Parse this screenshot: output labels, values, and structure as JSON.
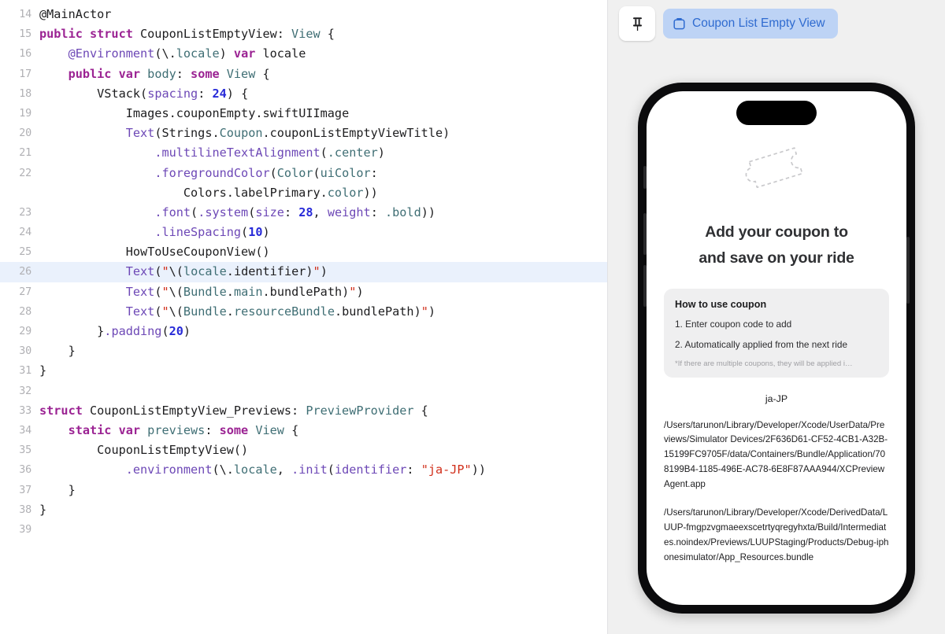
{
  "editor": {
    "language": "swift",
    "highlighted_line": 26,
    "first_line_number": 14,
    "lines": [
      {
        "n": 14,
        "tokens": [
          {
            "t": "@MainActor",
            "c": "plain"
          }
        ]
      },
      {
        "n": 15,
        "tokens": [
          {
            "t": "public struct ",
            "c": "kw"
          },
          {
            "t": "CouponListEmptyView",
            "c": "plain"
          },
          {
            "t": ": ",
            "c": "plain"
          },
          {
            "t": "View",
            "c": "type"
          },
          {
            "t": " {",
            "c": "plain"
          }
        ]
      },
      {
        "n": 16,
        "tokens": [
          {
            "t": "    ",
            "c": "plain"
          },
          {
            "t": "@Environment",
            "c": "attr"
          },
          {
            "t": "(\\.",
            "c": "plain"
          },
          {
            "t": "locale",
            "c": "prop"
          },
          {
            "t": ") ",
            "c": "plain"
          },
          {
            "t": "var ",
            "c": "kw"
          },
          {
            "t": "locale",
            "c": "plain"
          }
        ]
      },
      {
        "n": 17,
        "tokens": [
          {
            "t": "    ",
            "c": "plain"
          },
          {
            "t": "public var ",
            "c": "kw"
          },
          {
            "t": "body",
            "c": "type"
          },
          {
            "t": ": ",
            "c": "plain"
          },
          {
            "t": "some ",
            "c": "kw"
          },
          {
            "t": "View",
            "c": "type"
          },
          {
            "t": " {",
            "c": "plain"
          }
        ]
      },
      {
        "n": 18,
        "tokens": [
          {
            "t": "        ",
            "c": "plain"
          },
          {
            "t": "VStack",
            "c": "plain"
          },
          {
            "t": "(",
            "c": "plain"
          },
          {
            "t": "spacing",
            "c": "meth"
          },
          {
            "t": ": ",
            "c": "plain"
          },
          {
            "t": "24",
            "c": "num"
          },
          {
            "t": ") {",
            "c": "plain"
          }
        ]
      },
      {
        "n": 19,
        "tokens": [
          {
            "t": "            ",
            "c": "plain"
          },
          {
            "t": "Images",
            "c": "plain"
          },
          {
            "t": ".couponEmpty",
            "c": "plain"
          },
          {
            "t": ".swiftUIImage",
            "c": "plain"
          }
        ]
      },
      {
        "n": 20,
        "tokens": [
          {
            "t": "            ",
            "c": "plain"
          },
          {
            "t": "Text",
            "c": "meth"
          },
          {
            "t": "(",
            "c": "plain"
          },
          {
            "t": "Strings",
            "c": "plain"
          },
          {
            "t": ".",
            "c": "plain"
          },
          {
            "t": "Coupon",
            "c": "type"
          },
          {
            "t": ".couponListEmptyViewTitle",
            "c": "plain"
          },
          {
            "t": ")",
            "c": "plain"
          }
        ]
      },
      {
        "n": 21,
        "tokens": [
          {
            "t": "                ",
            "c": "plain"
          },
          {
            "t": ".multilineTextAlignment",
            "c": "meth"
          },
          {
            "t": "(",
            "c": "plain"
          },
          {
            "t": ".center",
            "c": "prop"
          },
          {
            "t": ")",
            "c": "plain"
          }
        ]
      },
      {
        "n": 22,
        "tokens": [
          {
            "t": "                ",
            "c": "plain"
          },
          {
            "t": ".foregroundColor",
            "c": "meth"
          },
          {
            "t": "(",
            "c": "plain"
          },
          {
            "t": "Color",
            "c": "type"
          },
          {
            "t": "(",
            "c": "plain"
          },
          {
            "t": "uiColor",
            "c": "type"
          },
          {
            "t": ":",
            "c": "plain"
          }
        ]
      },
      {
        "n": null,
        "tokens": [
          {
            "t": "                    ",
            "c": "plain"
          },
          {
            "t": "Colors",
            "c": "plain"
          },
          {
            "t": ".labelPrimary",
            "c": "plain"
          },
          {
            "t": ".",
            "c": "plain"
          },
          {
            "t": "color",
            "c": "prop"
          },
          {
            "t": "))",
            "c": "plain"
          }
        ]
      },
      {
        "n": 23,
        "tokens": [
          {
            "t": "                ",
            "c": "plain"
          },
          {
            "t": ".font",
            "c": "meth"
          },
          {
            "t": "(",
            "c": "plain"
          },
          {
            "t": ".system",
            "c": "meth"
          },
          {
            "t": "(",
            "c": "plain"
          },
          {
            "t": "size",
            "c": "meth"
          },
          {
            "t": ": ",
            "c": "plain"
          },
          {
            "t": "28",
            "c": "num"
          },
          {
            "t": ", ",
            "c": "plain"
          },
          {
            "t": "weight",
            "c": "meth"
          },
          {
            "t": ": ",
            "c": "plain"
          },
          {
            "t": ".bold",
            "c": "prop"
          },
          {
            "t": "))",
            "c": "plain"
          }
        ]
      },
      {
        "n": 24,
        "tokens": [
          {
            "t": "                ",
            "c": "plain"
          },
          {
            "t": ".lineSpacing",
            "c": "meth"
          },
          {
            "t": "(",
            "c": "plain"
          },
          {
            "t": "10",
            "c": "num"
          },
          {
            "t": ")",
            "c": "plain"
          }
        ]
      },
      {
        "n": 25,
        "tokens": [
          {
            "t": "            ",
            "c": "plain"
          },
          {
            "t": "HowToUseCouponView",
            "c": "plain"
          },
          {
            "t": "()",
            "c": "plain"
          }
        ]
      },
      {
        "n": 26,
        "tokens": [
          {
            "t": "            ",
            "c": "plain"
          },
          {
            "t": "Text",
            "c": "meth"
          },
          {
            "t": "(",
            "c": "plain"
          },
          {
            "t": "\"",
            "c": "str"
          },
          {
            "t": "\\(",
            "c": "plain"
          },
          {
            "t": "locale",
            "c": "prop"
          },
          {
            "t": ".identifier",
            "c": "plain"
          },
          {
            "t": ")",
            "c": "plain"
          },
          {
            "t": "\"",
            "c": "str"
          },
          {
            "t": ")",
            "c": "plain"
          }
        ]
      },
      {
        "n": 27,
        "tokens": [
          {
            "t": "            ",
            "c": "plain"
          },
          {
            "t": "Text",
            "c": "meth"
          },
          {
            "t": "(",
            "c": "plain"
          },
          {
            "t": "\"",
            "c": "str"
          },
          {
            "t": "\\(",
            "c": "plain"
          },
          {
            "t": "Bundle",
            "c": "type"
          },
          {
            "t": ".",
            "c": "plain"
          },
          {
            "t": "main",
            "c": "prop"
          },
          {
            "t": ".bundlePath",
            "c": "plain"
          },
          {
            "t": ")",
            "c": "plain"
          },
          {
            "t": "\"",
            "c": "str"
          },
          {
            "t": ")",
            "c": "plain"
          }
        ]
      },
      {
        "n": 28,
        "tokens": [
          {
            "t": "            ",
            "c": "plain"
          },
          {
            "t": "Text",
            "c": "meth"
          },
          {
            "t": "(",
            "c": "plain"
          },
          {
            "t": "\"",
            "c": "str"
          },
          {
            "t": "\\(",
            "c": "plain"
          },
          {
            "t": "Bundle",
            "c": "type"
          },
          {
            "t": ".",
            "c": "plain"
          },
          {
            "t": "resourceBundle",
            "c": "prop"
          },
          {
            "t": ".bundlePath",
            "c": "plain"
          },
          {
            "t": ")",
            "c": "plain"
          },
          {
            "t": "\"",
            "c": "str"
          },
          {
            "t": ")",
            "c": "plain"
          }
        ]
      },
      {
        "n": 29,
        "tokens": [
          {
            "t": "        }",
            "c": "plain"
          },
          {
            "t": ".padding",
            "c": "meth"
          },
          {
            "t": "(",
            "c": "plain"
          },
          {
            "t": "20",
            "c": "num"
          },
          {
            "t": ")",
            "c": "plain"
          }
        ]
      },
      {
        "n": 30,
        "tokens": [
          {
            "t": "    }",
            "c": "plain"
          }
        ]
      },
      {
        "n": 31,
        "tokens": [
          {
            "t": "}",
            "c": "plain"
          }
        ]
      },
      {
        "n": 32,
        "tokens": [
          {
            "t": "",
            "c": "plain"
          }
        ]
      },
      {
        "n": 33,
        "tokens": [
          {
            "t": "struct ",
            "c": "kw"
          },
          {
            "t": "CouponListEmptyView_Previews",
            "c": "plain"
          },
          {
            "t": ": ",
            "c": "plain"
          },
          {
            "t": "PreviewProvider",
            "c": "type"
          },
          {
            "t": " {",
            "c": "plain"
          }
        ]
      },
      {
        "n": 34,
        "tokens": [
          {
            "t": "    ",
            "c": "plain"
          },
          {
            "t": "static var ",
            "c": "kw"
          },
          {
            "t": "previews",
            "c": "type"
          },
          {
            "t": ": ",
            "c": "plain"
          },
          {
            "t": "some ",
            "c": "kw"
          },
          {
            "t": "View",
            "c": "type"
          },
          {
            "t": " {",
            "c": "plain"
          }
        ]
      },
      {
        "n": 35,
        "tokens": [
          {
            "t": "        ",
            "c": "plain"
          },
          {
            "t": "CouponListEmptyView",
            "c": "plain"
          },
          {
            "t": "()",
            "c": "plain"
          }
        ]
      },
      {
        "n": 36,
        "tokens": [
          {
            "t": "            ",
            "c": "plain"
          },
          {
            "t": ".environment",
            "c": "meth"
          },
          {
            "t": "(\\.",
            "c": "plain"
          },
          {
            "t": "locale",
            "c": "prop"
          },
          {
            "t": ", ",
            "c": "plain"
          },
          {
            "t": ".init",
            "c": "meth"
          },
          {
            "t": "(",
            "c": "plain"
          },
          {
            "t": "identifier",
            "c": "meth"
          },
          {
            "t": ": ",
            "c": "plain"
          },
          {
            "t": "\"ja-JP\"",
            "c": "str"
          },
          {
            "t": "))",
            "c": "plain"
          }
        ]
      },
      {
        "n": 37,
        "tokens": [
          {
            "t": "    }",
            "c": "plain"
          }
        ]
      },
      {
        "n": 38,
        "tokens": [
          {
            "t": "}",
            "c": "plain"
          }
        ]
      },
      {
        "n": 39,
        "tokens": [
          {
            "t": "",
            "c": "plain"
          }
        ]
      }
    ]
  },
  "preview": {
    "toolbar": {
      "pin_icon": "pin-icon",
      "tab_icon": "device-icon",
      "tab_label": "Coupon List Empty View",
      "tab_color": "#bdd3f5",
      "tab_text_color": "#2f6bd0"
    },
    "device": {
      "name": "iphone-15-pro",
      "frame_color": "#0b0b0d",
      "screen_color": "#ffffff"
    },
    "screen": {
      "coupon_icon": "coupon-ticket-dashed-icon",
      "title_line1": "Add your coupon to",
      "title_line2": "and save on your ride",
      "howto": {
        "title": "How to use coupon",
        "steps": [
          "1. Enter coupon code to add",
          "2. Automatically applied from the next ride"
        ],
        "note": "*If there are multiple coupons, they will be applied i…"
      },
      "locale_identifier": "ja-JP",
      "paths": [
        "/Users/tarunon/Library/Developer/Xcode/UserData/Previews/Simulator Devices/2F636D61-CF52-4CB1-A32B-15199FC9705F/data/Containers/Bundle/Application/708199B4-1185-496E-AC78-6E8F87AAA944/XCPreviewAgent.app",
        "/Users/tarunon/Library/Developer/Xcode/DerivedData/LUUP-fmgpzvgmaeexscetrtyqregyhxta/Build/Intermediates.noindex/Previews/LUUPStaging/Products/Debug-iphonesimulator/App_Resources.bundle"
      ]
    }
  }
}
